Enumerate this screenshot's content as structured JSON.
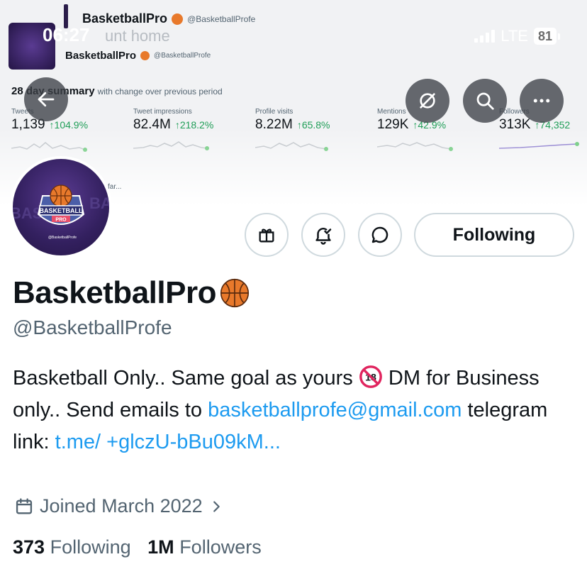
{
  "status_bar": {
    "time": "06:27",
    "network": "LTE",
    "battery": "81"
  },
  "banner": {
    "header_name": "BasketballPro",
    "header_handle": "@BasketballProfe",
    "overlay_text": "unt home",
    "card_name": "BasketballPro",
    "card_handle": "@BasketballProfe",
    "summary_title": "28 day summary",
    "summary_subtitle": "with change over previous period",
    "stats": [
      {
        "label": "Tweets",
        "value": "1,139",
        "change": "↑104.9%"
      },
      {
        "label": "Tweet impressions",
        "value": "82.4M",
        "change": "↑218.2%"
      },
      {
        "label": "Profile visits",
        "value": "8.22M",
        "change": "↑65.8%"
      },
      {
        "label": "Mentions",
        "value": "129K",
        "change": "↑42.9%"
      },
      {
        "label": "Followers",
        "value": "313K",
        "change": "↑74,352"
      }
    ],
    "footer_text": "far..."
  },
  "avatar": {
    "logo_line1": "BASKETBALL",
    "logo_line2": "PRO",
    "logo_handle": "@BasketballProfe"
  },
  "profile": {
    "display_name": "BasketballPro",
    "handle": "@BasketballProfe",
    "follow_label": "Following",
    "bio": {
      "part1": "Basketball Only.. Same goal as yours ",
      "part2": " DM for Business only.. Send emails to ",
      "email": "basketballprofe@gmail.com",
      "part3": " telegram link: ",
      "link": "t.me/ +glczU-bBu09kM..."
    },
    "joined": "Joined March 2022",
    "following_count": "373",
    "following_label": "Following",
    "followers_count": "1M",
    "followers_label": "Followers"
  },
  "icons": {
    "back": "arrow-left-icon",
    "mute": "eye-slash-icon",
    "search": "search-icon",
    "more": "more-icon",
    "gift": "gift-icon",
    "notify": "bell-icon",
    "message": "message-icon",
    "calendar": "calendar-icon",
    "chevron": "chevron-right-icon"
  },
  "colors": {
    "link": "#1d9bf0",
    "secondary_text": "#536471",
    "positive": "#1f9e57",
    "ball": "#e8792b"
  }
}
